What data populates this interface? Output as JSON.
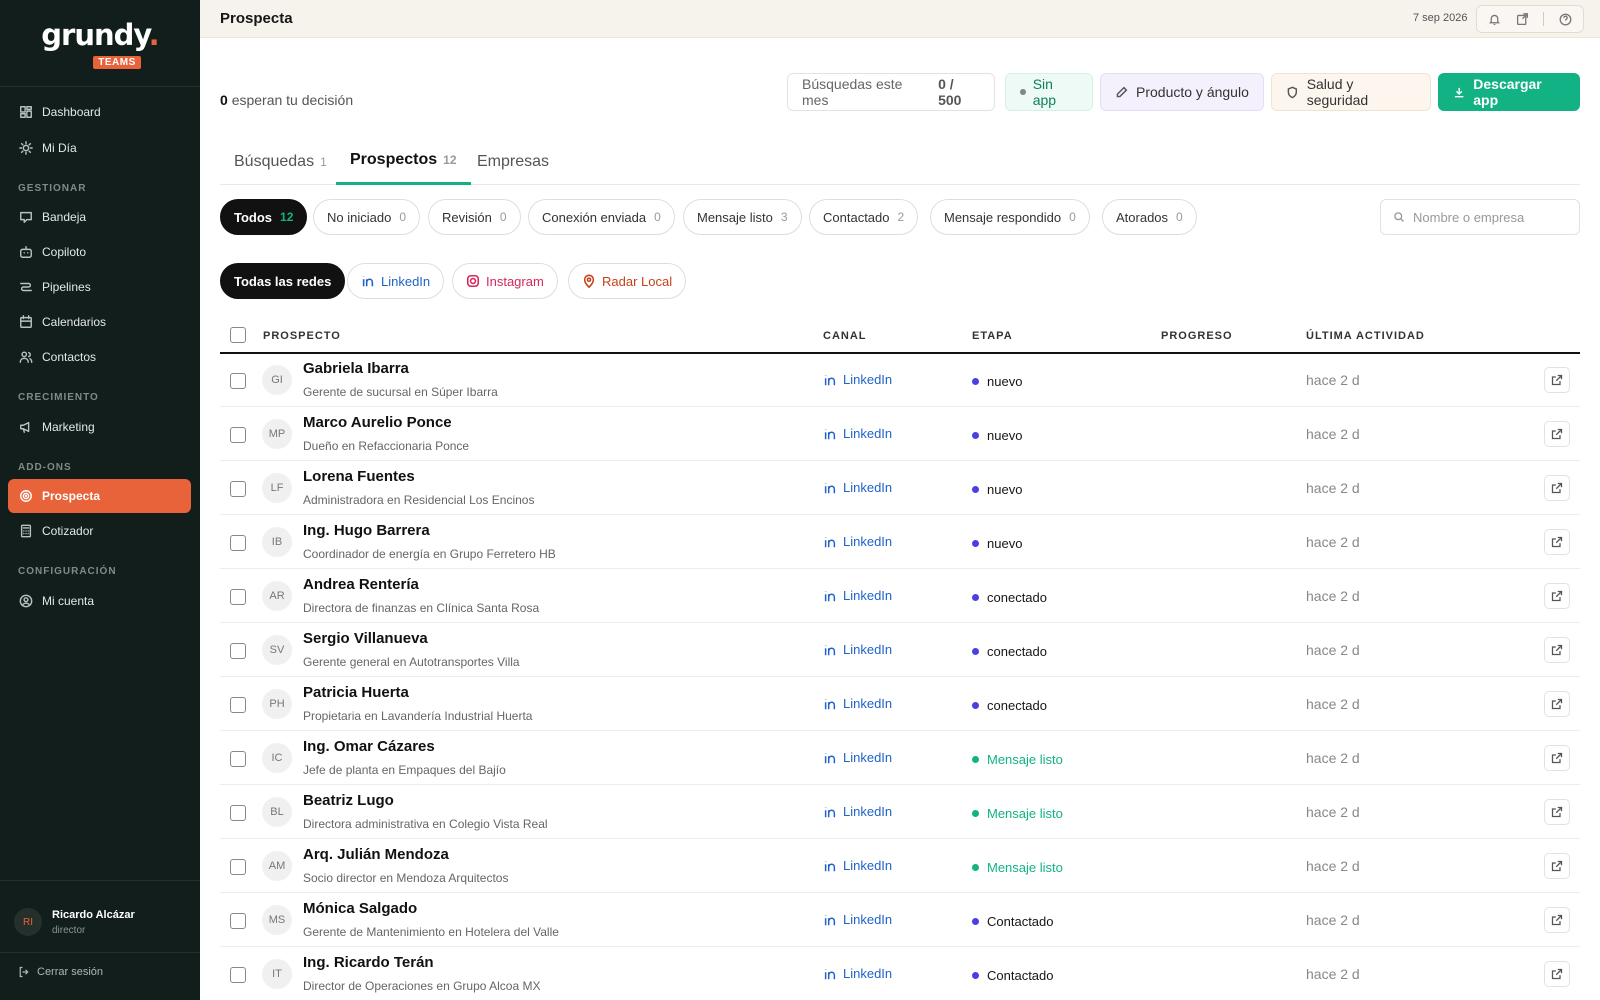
{
  "brand": {
    "logo_word": "grundy",
    "logo_dot": ".",
    "badge": "TEAMS"
  },
  "sidebar": {
    "items": [
      {
        "label": "Dashboard",
        "icon": "dashboard-icon"
      },
      {
        "label": "Mi Día",
        "icon": "sun-icon"
      }
    ],
    "sections": [
      {
        "title": "GESTIONAR",
        "items": [
          {
            "label": "Bandeja",
            "icon": "inbox-icon"
          },
          {
            "label": "Copiloto",
            "icon": "bot-icon"
          },
          {
            "label": "Pipelines",
            "icon": "pipeline-icon"
          },
          {
            "label": "Calendarios",
            "icon": "calendar-icon"
          },
          {
            "label": "Contactos",
            "icon": "users-icon"
          }
        ]
      },
      {
        "title": "CRECIMIENTO",
        "items": [
          {
            "label": "Marketing",
            "icon": "megaphone-icon"
          }
        ]
      },
      {
        "title": "ADD-ONS",
        "items": [
          {
            "label": "Prospecta",
            "icon": "target-icon",
            "active": true
          },
          {
            "label": "Cotizador",
            "icon": "calculator-icon"
          }
        ]
      },
      {
        "title": "CONFIGURACIÓN",
        "items": [
          {
            "label": "Mi cuenta",
            "icon": "user-circle-icon"
          }
        ]
      }
    ],
    "user": {
      "initials": "RI",
      "name": "Ricardo Alcázar",
      "role": "director"
    },
    "logout_label": "Cerrar sesión"
  },
  "topbar": {
    "title": "Prospecta",
    "date": "7 sep 2026"
  },
  "summary": {
    "pending_count": "0",
    "pending_text": "esperan tu decisión"
  },
  "actions": {
    "searches_label": "Búsquedas este mes",
    "searches_value": "0 / 500",
    "no_app": "Sin app",
    "product": "Producto y ángulo",
    "safety": "Salud y seguridad",
    "download": "Descargar app"
  },
  "tabs": [
    {
      "label": "Búsquedas",
      "count": "1"
    },
    {
      "label": "Prospectos",
      "count": "12",
      "active": true
    },
    {
      "label": "Empresas",
      "count": ""
    }
  ],
  "filters": [
    {
      "label": "Todos",
      "count": "12",
      "active": true
    },
    {
      "label": "No iniciado",
      "count": "0"
    },
    {
      "label": "Revisión",
      "count": "0"
    },
    {
      "label": "Conexión enviada",
      "count": "0"
    },
    {
      "label": "Mensaje listo",
      "count": "3"
    },
    {
      "label": "Contactado",
      "count": "2"
    },
    {
      "label": "Mensaje respondido",
      "count": "0"
    },
    {
      "label": "Atorados",
      "count": "0"
    }
  ],
  "search": {
    "placeholder": "Nombre o empresa"
  },
  "networks": [
    {
      "label": "Todas las redes",
      "active": true
    },
    {
      "label": "LinkedIn",
      "color": "#1f63c9"
    },
    {
      "label": "Instagram",
      "color": "#d6285a"
    },
    {
      "label": "Radar Local",
      "color": "#c8401a"
    }
  ],
  "columns": [
    "PROSPECTO",
    "CANAL",
    "ETAPA",
    "PROGRESO",
    "ÚLTIMA ACTIVIDAD"
  ],
  "stage_colors": {
    "nuevo": "#4a3fe0",
    "conectado": "#4a3fe0",
    "Mensaje listo": "#13b285",
    "Contactado": "#4a3fe0"
  },
  "rows": [
    {
      "initials": "GI",
      "name": "Gabriela Ibarra",
      "subtitle": "Gerente de sucursal en Súper Ibarra",
      "canal": "LinkedIn",
      "etapa": "nuevo",
      "last": "hace 2 d"
    },
    {
      "initials": "MP",
      "name": "Marco Aurelio Ponce",
      "subtitle": "Dueño en Refaccionaria Ponce",
      "canal": "LinkedIn",
      "etapa": "nuevo",
      "last": "hace 2 d"
    },
    {
      "initials": "LF",
      "name": "Lorena Fuentes",
      "subtitle": "Administradora en Residencial Los Encinos",
      "canal": "LinkedIn",
      "etapa": "nuevo",
      "last": "hace 2 d"
    },
    {
      "initials": "IB",
      "name": "Ing. Hugo Barrera",
      "subtitle": "Coordinador de energía en Grupo Ferretero HB",
      "canal": "LinkedIn",
      "etapa": "nuevo",
      "last": "hace 2 d"
    },
    {
      "initials": "AR",
      "name": "Andrea Rentería",
      "subtitle": "Directora de finanzas en Clínica Santa Rosa",
      "canal": "LinkedIn",
      "etapa": "conectado",
      "last": "hace 2 d"
    },
    {
      "initials": "SV",
      "name": "Sergio Villanueva",
      "subtitle": "Gerente general en Autotransportes Villa",
      "canal": "LinkedIn",
      "etapa": "conectado",
      "last": "hace 2 d"
    },
    {
      "initials": "PH",
      "name": "Patricia Huerta",
      "subtitle": "Propietaria en Lavandería Industrial Huerta",
      "canal": "LinkedIn",
      "etapa": "conectado",
      "last": "hace 2 d"
    },
    {
      "initials": "IC",
      "name": "Ing. Omar Cázares",
      "subtitle": "Jefe de planta en Empaques del Bajío",
      "canal": "LinkedIn",
      "etapa": "Mensaje listo",
      "last": "hace 2 d"
    },
    {
      "initials": "BL",
      "name": "Beatriz Lugo",
      "subtitle": "Directora administrativa en Colegio Vista Real",
      "canal": "LinkedIn",
      "etapa": "Mensaje listo",
      "last": "hace 2 d"
    },
    {
      "initials": "AM",
      "name": "Arq. Julián Mendoza",
      "subtitle": "Socio director en Mendoza Arquitectos",
      "canal": "LinkedIn",
      "etapa": "Mensaje listo",
      "last": "hace 2 d"
    },
    {
      "initials": "MS",
      "name": "Mónica Salgado",
      "subtitle": "Gerente de Mantenimiento en Hotelera del Valle",
      "canal": "LinkedIn",
      "etapa": "Contactado",
      "last": "hace 2 d"
    },
    {
      "initials": "IT",
      "name": "Ing. Ricardo Terán",
      "subtitle": "Director de Operaciones en Grupo Alcoa MX",
      "canal": "LinkedIn",
      "etapa": "Contactado",
      "last": "hace 2 d"
    }
  ]
}
